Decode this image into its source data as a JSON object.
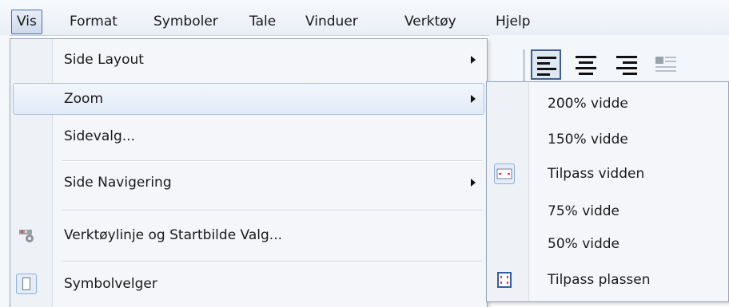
{
  "menubar": {
    "items": [
      {
        "label": "Vis",
        "active": true
      },
      {
        "label": "Format"
      },
      {
        "label": "Symboler"
      },
      {
        "label": "Tale"
      },
      {
        "label": "Vinduer"
      },
      {
        "label": "Verktøy"
      },
      {
        "label": "Hjelp"
      }
    ]
  },
  "vis_menu": {
    "items": [
      {
        "label": "Side Layout",
        "has_submenu": true
      },
      {
        "label": "Zoom",
        "has_submenu": true,
        "highlighted": true
      },
      {
        "label": "Sidevalg..."
      },
      {
        "label": "Side Navigering",
        "has_submenu": true
      },
      {
        "label": "Verktøylinje og Startbilde Valg...",
        "icon": "toolbar-settings-icon"
      },
      {
        "label": "Symbolvelger",
        "icon": "symbol-picker-icon",
        "checked": true
      }
    ]
  },
  "zoom_submenu": {
    "items": [
      {
        "label": "200% vidde"
      },
      {
        "label": "150% vidde"
      },
      {
        "label": "Tilpass vidden",
        "icon": "fit-width-icon",
        "checked": true
      },
      {
        "label": "75% vidde"
      },
      {
        "label": "50% vidde"
      },
      {
        "label": "Tilpass plassen",
        "icon": "fit-page-icon"
      }
    ]
  },
  "colors": {
    "menu_bg": "#f4f6f9",
    "highlight_border": "#a9c2e3",
    "icon_red": "#e03a3a",
    "icon_blue": "#2d5fa8"
  }
}
